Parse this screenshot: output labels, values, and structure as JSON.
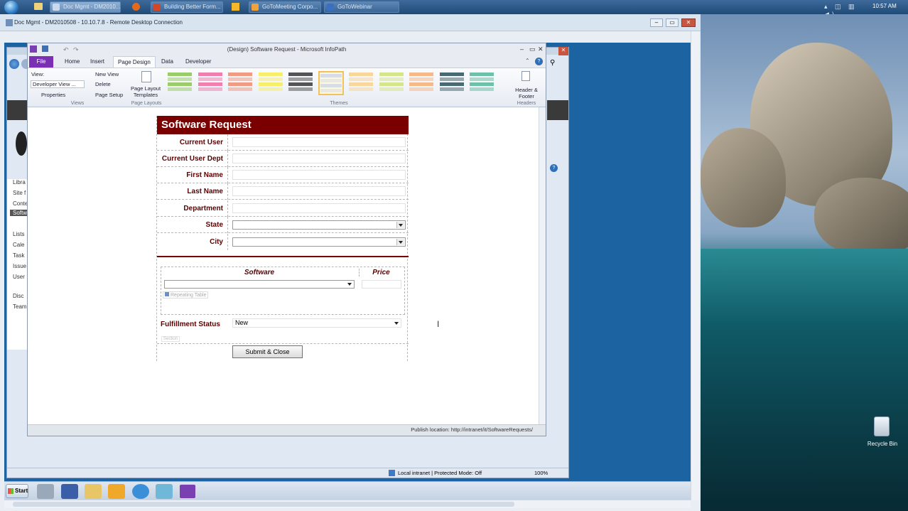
{
  "taskbar_top": {
    "tabs": [
      "Doc Mgmt - DM2010...",
      "Building Better Form...",
      "GoToMeeting Corpo...",
      "GoToWebinar"
    ],
    "clock": "10:57 AM"
  },
  "rdp": {
    "title": "Doc Mgmt - DM2010508 - 10.10.7.8 - Remote Desktop Connection"
  },
  "infopath": {
    "title": "(Design) Software Request - Microsoft InfoPath",
    "tabs": [
      "File",
      "Home",
      "Insert",
      "Page Design",
      "Data",
      "Developer"
    ],
    "active_tab": "Page Design",
    "ribbon": {
      "view_label": "View:",
      "view_value": "Developer View ...",
      "new_view": "New View",
      "delete": "Delete",
      "properties": "Properties",
      "page_setup": "Page Setup",
      "views_group": "Views",
      "layout_btn": "Page Layout Templates",
      "layouts_group": "Page Layouts",
      "themes_group": "Themes",
      "header_btn": "Header & Footer",
      "headers_group": "Headers"
    },
    "theme_colors": [
      "#9acd6a",
      "#f07fb0",
      "#f29b83",
      "#f7ef6a",
      "#555555",
      "#d6dde4",
      "#f9d69a",
      "#d4e58a",
      "#f5b98a",
      "#4a6a73",
      "#6fc0a9"
    ],
    "status": "Publish location: http://intranet/it/SoftwareRequests/"
  },
  "form": {
    "title": "Software Request",
    "fields": [
      {
        "label": "Current User"
      },
      {
        "label": "Current User Dept"
      },
      {
        "label": "First Name"
      },
      {
        "label": "Last Name"
      },
      {
        "label": "Department"
      }
    ],
    "selects": [
      {
        "label": "State",
        "value": ""
      },
      {
        "label": "City",
        "value": ""
      }
    ],
    "table": {
      "col_software": "Software",
      "col_price": "Price",
      "tag": "Repeating Table"
    },
    "fulfillment": {
      "label": "Fulfillment Status",
      "value": "New",
      "section_tag": "Section"
    },
    "submit": "Submit & Close"
  },
  "ie": {
    "sidebar": [
      "Libra",
      "Site f",
      "Conte",
      "Softw",
      "Lists",
      "Cale",
      "Task",
      "Issue",
      "User",
      "Disc",
      "Team"
    ],
    "status_zone": "Local intranet | Protected Mode: Off",
    "zoom": "100%"
  },
  "desktop": {
    "recycle_bin": "Recycle Bin"
  },
  "wintask": {
    "start": "Start"
  }
}
